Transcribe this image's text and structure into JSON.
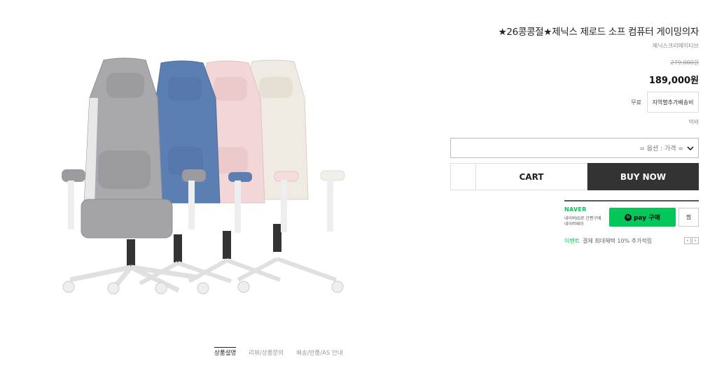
{
  "product": {
    "title": "★26콩콩절★제닉스 제로드 소프 컴퓨터 게이밍의자",
    "brand": "제닉스크리에이티브",
    "original_price": "279,000원",
    "price": "189,000원"
  },
  "shipping": {
    "fee_label": "무료",
    "extra_button": "지역별추가배송비",
    "method": "택배"
  },
  "options": {
    "select_text": "= 옵션 : 가격 ="
  },
  "actions": {
    "cart": "CART",
    "buy_now": "BUY NOW"
  },
  "naver": {
    "logo": "NAVER",
    "sub1": "네이버ID로 간편구매",
    "sub2": "네이버페이",
    "pay_n": "N",
    "pay_label": "pay 구매",
    "zzim": "찜",
    "event_label": "이벤트",
    "event_text": "결제 최대혜택 10% 추가적립",
    "prev": "‹",
    "next": "›"
  },
  "tabs": [
    {
      "label": "상품설명",
      "active": true
    },
    {
      "label": "리뷰/상품문의",
      "active": false
    },
    {
      "label": "배송/반품/AS 안내",
      "active": false
    }
  ],
  "colors": {
    "chairs": [
      "#a9a9ad",
      "#5b7fb3",
      "#f1d4d6",
      "#efe8df"
    ],
    "naver_green": "#03c75a",
    "buy_now_bg": "#333333"
  }
}
